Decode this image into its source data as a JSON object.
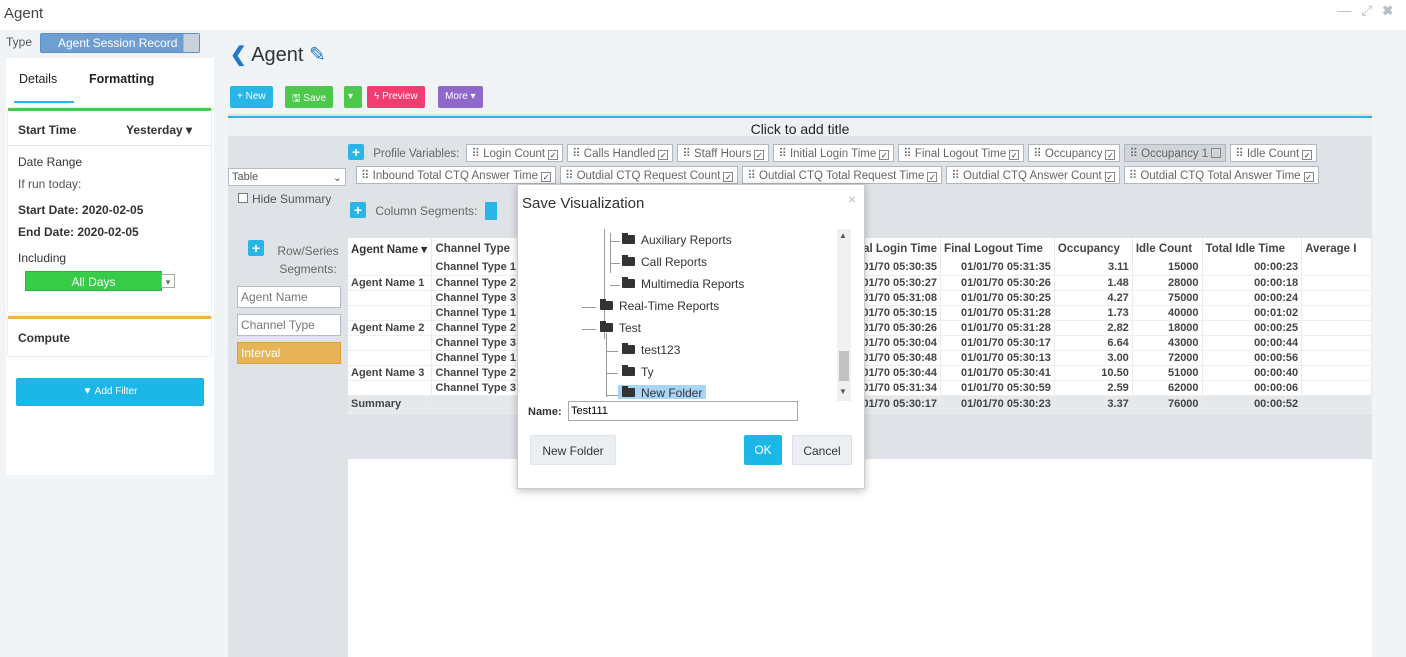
{
  "window": {
    "title": "Agent",
    "controls": "— ⤢ ✖"
  },
  "type": {
    "label": "Type",
    "value": "Agent Session Record"
  },
  "tabs": [
    "Details",
    "Formatting"
  ],
  "details": {
    "start_time_label": "Start Time",
    "start_time_value": "Yesterday ▾",
    "date_range": "Date Range",
    "if_run_today": "If run today:",
    "start_date": "Start Date: 2020-02-05",
    "end_date": "End Date: 2020-02-05",
    "including": "Including",
    "all_days": "All Days"
  },
  "compute": {
    "label": "Compute"
  },
  "add_filter": "▼ Add Filter",
  "header": {
    "chevron": "❮",
    "title": "Agent",
    "edit_icon": "✎"
  },
  "toolbar": {
    "new": "+ New",
    "save": "🖫 Save",
    "save_caret": "▾",
    "preview": "ϟ Preview",
    "more": "More ▾"
  },
  "viz": {
    "title": "Click to add title",
    "profile_variables_label": "Profile Variables:",
    "profile_variables": [
      {
        "label": "Login Count",
        "checked": true
      },
      {
        "label": "Calls Handled",
        "checked": true
      },
      {
        "label": "Staff Hours",
        "checked": true
      },
      {
        "label": "Initial Login Time",
        "checked": true
      },
      {
        "label": "Final Logout Time",
        "checked": true
      },
      {
        "label": "Occupancy",
        "checked": true
      },
      {
        "label": "Occupancy 1",
        "checked": false
      },
      {
        "label": "Idle Count",
        "checked": true
      }
    ],
    "profile_variables2": [
      {
        "label": "Inbound Total CTQ Answer Time",
        "checked": true
      },
      {
        "label": "Outdial CTQ Request Count",
        "checked": true
      },
      {
        "label": "Outdial CTQ Total Request Time",
        "checked": true
      },
      {
        "label": "Outdial CTQ Answer Count",
        "checked": true
      },
      {
        "label": "Outdial CTQ Total Answer Time",
        "checked": true
      }
    ],
    "display_type": "Table",
    "hide_summary": "Hide Summary",
    "column_segments_label": "Column Segments:",
    "row_series_label": "Row/Series Segments:",
    "row_segments": [
      "Agent Name",
      "Channel Type",
      "Interval"
    ]
  },
  "table": {
    "headers": [
      "Agent Name ▾",
      "Channel Type",
      "ial Login Time",
      "Final Logout Time",
      "Occupancy",
      "Idle Count",
      "Total Idle Time",
      "Average I"
    ],
    "rows": [
      {
        "agent": "",
        "channel": "Channel Type 1",
        "login": "1/01/70 05:30:35",
        "logout": "01/01/70 05:31:35",
        "occ": "3.11",
        "idle": "15000",
        "idle_time": "00:00:23"
      },
      {
        "agent": "Agent Name 1",
        "channel": "Channel Type 2",
        "login": "1/01/70 05:30:27",
        "logout": "01/01/70 05:30:26",
        "occ": "1.48",
        "idle": "28000",
        "idle_time": "00:00:18"
      },
      {
        "agent": "",
        "channel": "Channel Type 3",
        "login": "1/01/70 05:31:08",
        "logout": "01/01/70 05:30:25",
        "occ": "4.27",
        "idle": "75000",
        "idle_time": "00:00:24"
      },
      {
        "agent": "",
        "channel": "Channel Type 1",
        "login": "1/01/70 05:30:15",
        "logout": "01/01/70 05:31:28",
        "occ": "1.73",
        "idle": "40000",
        "idle_time": "00:01:02"
      },
      {
        "agent": "Agent Name 2",
        "channel": "Channel Type 2",
        "login": "1/01/70 05:30:26",
        "logout": "01/01/70 05:31:28",
        "occ": "2.82",
        "idle": "18000",
        "idle_time": "00:00:25"
      },
      {
        "agent": "",
        "channel": "Channel Type 3",
        "login": "1/01/70 05:30:04",
        "logout": "01/01/70 05:30:17",
        "occ": "6.64",
        "idle": "43000",
        "idle_time": "00:00:44"
      },
      {
        "agent": "",
        "channel": "Channel Type 1",
        "login": "1/01/70 05:30:48",
        "logout": "01/01/70 05:30:13",
        "occ": "3.00",
        "idle": "72000",
        "idle_time": "00:00:56"
      },
      {
        "agent": "Agent Name 3",
        "channel": "Channel Type 2",
        "login": "1/01/70 05:30:44",
        "logout": "01/01/70 05:30:41",
        "occ": "10.50",
        "idle": "51000",
        "idle_time": "00:00:40"
      },
      {
        "agent": "",
        "channel": "Channel Type 3",
        "login": "1/01/70 05:31:34",
        "logout": "01/01/70 05:30:59",
        "occ": "2.59",
        "idle": "62000",
        "idle_time": "00:00:06"
      }
    ],
    "summary": {
      "agent": "Summary",
      "channel": "",
      "login": "1/01/70 05:30:17",
      "logout": "01/01/70 05:30:23",
      "occ": "3.37",
      "idle": "76000",
      "idle_time": "00:00:52"
    }
  },
  "dialog": {
    "title": "Save Visualization",
    "close": "×",
    "tree": [
      "Auxiliary Reports",
      "Call Reports",
      "Multimedia Reports",
      "Real-Time Reports",
      "Test",
      "test123",
      "Ty",
      "New Folder"
    ],
    "name_label": "Name:",
    "name_value": "Test111",
    "new_folder": "New Folder",
    "ok": "OK",
    "cancel": "Cancel"
  }
}
